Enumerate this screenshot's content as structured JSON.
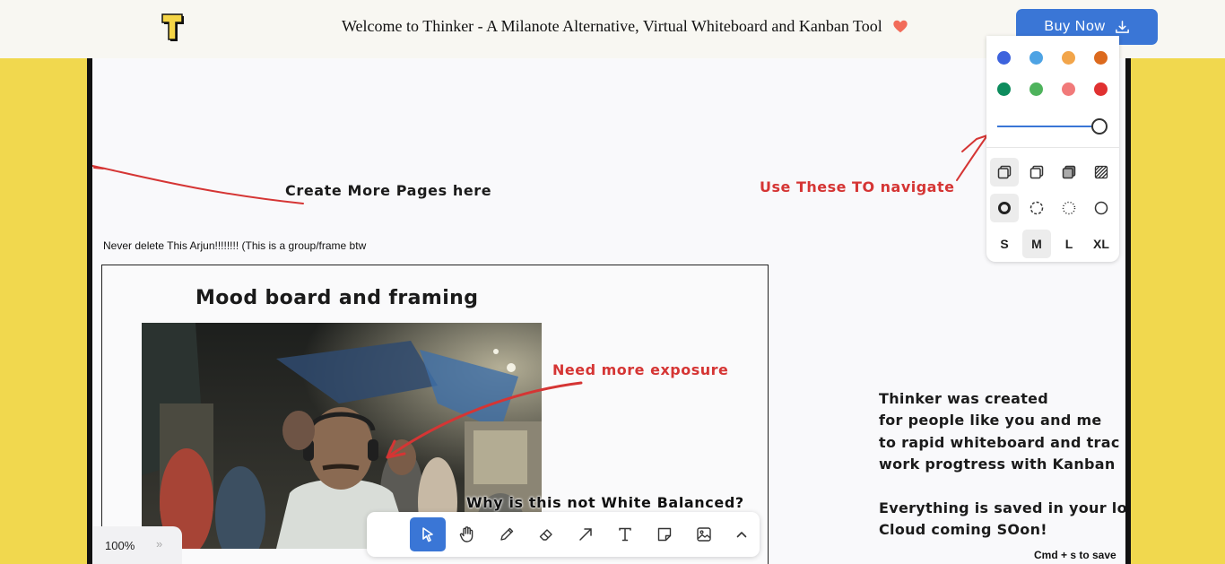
{
  "banner": {
    "title": "Welcome to Thinker - A Milanote Alternative, Virtual Whiteboard and Kanban Tool",
    "buy_label": "Buy Now",
    "logo_icon": "thinker-t-logo",
    "heart_icon": "heart-icon",
    "download_icon": "download-icon"
  },
  "canvas": {
    "pages_note": "Create More Pages here",
    "nav_note": "Use These TO navigate",
    "group_label": "Never delete This Arjun!!!!!!!! (This is a group/frame btw",
    "frame_title": "Mood board and framing",
    "exposure_note": "Need more exposure",
    "wb_note": "Why is this not White Balanced?",
    "about_lines": [
      "Thinker was created",
      "for people like you and me",
      "to rapid whiteboard and trac",
      "work progtress with Kanban",
      "",
      "Everything is saved in your lo",
      "Cloud coming SOon!"
    ]
  },
  "style_panel": {
    "colors_row1": [
      "#3d63dd",
      "#4ea3e4",
      "#f2a54a",
      "#dc6a1e"
    ],
    "colors_row2": [
      "#0d8c5d",
      "#4eb35c",
      "#f17a7a",
      "#e03131"
    ],
    "opacity": 1.0,
    "fill_options": [
      "fill-none",
      "fill-semi",
      "fill-solid",
      "fill-pattern"
    ],
    "dash_options": [
      "dash-draw",
      "dash-dashed",
      "dash-dotted",
      "dash-solid"
    ],
    "sizes": [
      "S",
      "M",
      "L",
      "XL"
    ],
    "selected_size": "M"
  },
  "zoom": {
    "value": "100%",
    "arrows": "»"
  },
  "toolbar": {
    "tools": [
      "select",
      "hand",
      "draw",
      "eraser",
      "arrow",
      "text",
      "note",
      "image",
      "more"
    ],
    "active_tool": "select"
  },
  "save_hint": "Cmd + s to save"
}
